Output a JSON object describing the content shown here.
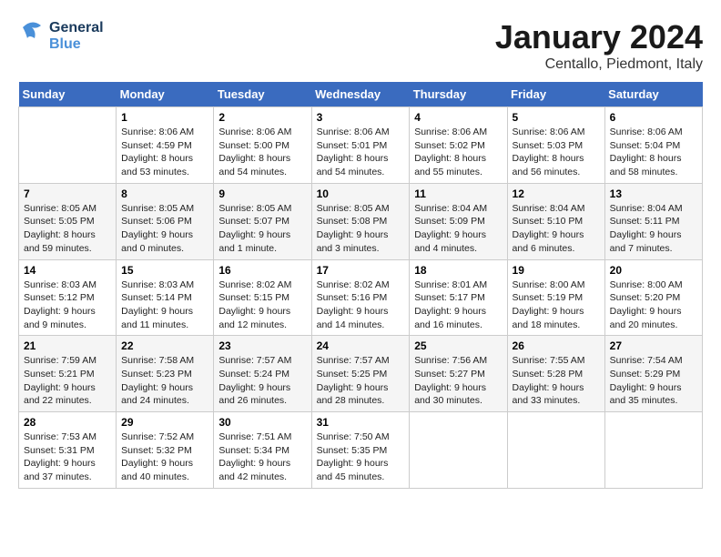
{
  "header": {
    "logo_line1": "General",
    "logo_line2": "Blue",
    "month_title": "January 2024",
    "location": "Centallo, Piedmont, Italy"
  },
  "weekdays": [
    "Sunday",
    "Monday",
    "Tuesday",
    "Wednesday",
    "Thursday",
    "Friday",
    "Saturday"
  ],
  "weeks": [
    [
      {
        "day": "",
        "info": ""
      },
      {
        "day": "1",
        "info": "Sunrise: 8:06 AM\nSunset: 4:59 PM\nDaylight: 8 hours\nand 53 minutes."
      },
      {
        "day": "2",
        "info": "Sunrise: 8:06 AM\nSunset: 5:00 PM\nDaylight: 8 hours\nand 54 minutes."
      },
      {
        "day": "3",
        "info": "Sunrise: 8:06 AM\nSunset: 5:01 PM\nDaylight: 8 hours\nand 54 minutes."
      },
      {
        "day": "4",
        "info": "Sunrise: 8:06 AM\nSunset: 5:02 PM\nDaylight: 8 hours\nand 55 minutes."
      },
      {
        "day": "5",
        "info": "Sunrise: 8:06 AM\nSunset: 5:03 PM\nDaylight: 8 hours\nand 56 minutes."
      },
      {
        "day": "6",
        "info": "Sunrise: 8:06 AM\nSunset: 5:04 PM\nDaylight: 8 hours\nand 58 minutes."
      }
    ],
    [
      {
        "day": "7",
        "info": "Sunrise: 8:05 AM\nSunset: 5:05 PM\nDaylight: 8 hours\nand 59 minutes."
      },
      {
        "day": "8",
        "info": "Sunrise: 8:05 AM\nSunset: 5:06 PM\nDaylight: 9 hours\nand 0 minutes."
      },
      {
        "day": "9",
        "info": "Sunrise: 8:05 AM\nSunset: 5:07 PM\nDaylight: 9 hours\nand 1 minute."
      },
      {
        "day": "10",
        "info": "Sunrise: 8:05 AM\nSunset: 5:08 PM\nDaylight: 9 hours\nand 3 minutes."
      },
      {
        "day": "11",
        "info": "Sunrise: 8:04 AM\nSunset: 5:09 PM\nDaylight: 9 hours\nand 4 minutes."
      },
      {
        "day": "12",
        "info": "Sunrise: 8:04 AM\nSunset: 5:10 PM\nDaylight: 9 hours\nand 6 minutes."
      },
      {
        "day": "13",
        "info": "Sunrise: 8:04 AM\nSunset: 5:11 PM\nDaylight: 9 hours\nand 7 minutes."
      }
    ],
    [
      {
        "day": "14",
        "info": "Sunrise: 8:03 AM\nSunset: 5:12 PM\nDaylight: 9 hours\nand 9 minutes."
      },
      {
        "day": "15",
        "info": "Sunrise: 8:03 AM\nSunset: 5:14 PM\nDaylight: 9 hours\nand 11 minutes."
      },
      {
        "day": "16",
        "info": "Sunrise: 8:02 AM\nSunset: 5:15 PM\nDaylight: 9 hours\nand 12 minutes."
      },
      {
        "day": "17",
        "info": "Sunrise: 8:02 AM\nSunset: 5:16 PM\nDaylight: 9 hours\nand 14 minutes."
      },
      {
        "day": "18",
        "info": "Sunrise: 8:01 AM\nSunset: 5:17 PM\nDaylight: 9 hours\nand 16 minutes."
      },
      {
        "day": "19",
        "info": "Sunrise: 8:00 AM\nSunset: 5:19 PM\nDaylight: 9 hours\nand 18 minutes."
      },
      {
        "day": "20",
        "info": "Sunrise: 8:00 AM\nSunset: 5:20 PM\nDaylight: 9 hours\nand 20 minutes."
      }
    ],
    [
      {
        "day": "21",
        "info": "Sunrise: 7:59 AM\nSunset: 5:21 PM\nDaylight: 9 hours\nand 22 minutes."
      },
      {
        "day": "22",
        "info": "Sunrise: 7:58 AM\nSunset: 5:23 PM\nDaylight: 9 hours\nand 24 minutes."
      },
      {
        "day": "23",
        "info": "Sunrise: 7:57 AM\nSunset: 5:24 PM\nDaylight: 9 hours\nand 26 minutes."
      },
      {
        "day": "24",
        "info": "Sunrise: 7:57 AM\nSunset: 5:25 PM\nDaylight: 9 hours\nand 28 minutes."
      },
      {
        "day": "25",
        "info": "Sunrise: 7:56 AM\nSunset: 5:27 PM\nDaylight: 9 hours\nand 30 minutes."
      },
      {
        "day": "26",
        "info": "Sunrise: 7:55 AM\nSunset: 5:28 PM\nDaylight: 9 hours\nand 33 minutes."
      },
      {
        "day": "27",
        "info": "Sunrise: 7:54 AM\nSunset: 5:29 PM\nDaylight: 9 hours\nand 35 minutes."
      }
    ],
    [
      {
        "day": "28",
        "info": "Sunrise: 7:53 AM\nSunset: 5:31 PM\nDaylight: 9 hours\nand 37 minutes."
      },
      {
        "day": "29",
        "info": "Sunrise: 7:52 AM\nSunset: 5:32 PM\nDaylight: 9 hours\nand 40 minutes."
      },
      {
        "day": "30",
        "info": "Sunrise: 7:51 AM\nSunset: 5:34 PM\nDaylight: 9 hours\nand 42 minutes."
      },
      {
        "day": "31",
        "info": "Sunrise: 7:50 AM\nSunset: 5:35 PM\nDaylight: 9 hours\nand 45 minutes."
      },
      {
        "day": "",
        "info": ""
      },
      {
        "day": "",
        "info": ""
      },
      {
        "day": "",
        "info": ""
      }
    ]
  ]
}
